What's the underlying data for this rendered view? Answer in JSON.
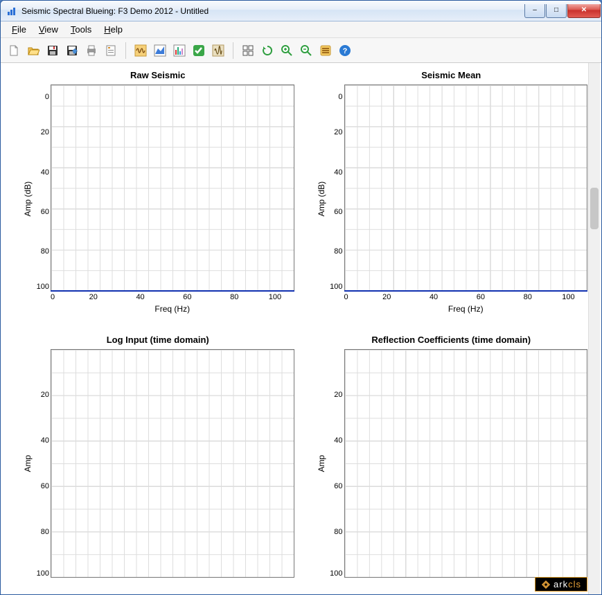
{
  "window": {
    "title": "Seismic Spectral Blueing: F3 Demo 2012 - Untitled"
  },
  "menubar": {
    "file": "File",
    "view": "View",
    "tools": "Tools",
    "help": "Help"
  },
  "toolbar": {
    "new": "new",
    "open": "open",
    "save": "save",
    "saveas": "save-as",
    "print": "print",
    "config": "config",
    "seismic": "seismic",
    "wave": "wave",
    "spectrum": "spectrum",
    "check": "check",
    "process": "process",
    "grid": "grid-view",
    "refresh": "refresh",
    "zoomin": "zoom-in",
    "zoomout": "zoom-out",
    "fit": "fit",
    "help": "help"
  },
  "chart_data": [
    {
      "id": "raw_seismic",
      "type": "line",
      "title": "Raw Seismic",
      "xlabel": "Freq (Hz)",
      "ylabel": "Amp (dB)",
      "xlim": [
        0,
        100
      ],
      "ylim": [
        0,
        100
      ],
      "xticks": [
        0,
        20,
        40,
        60,
        80,
        100
      ],
      "yticks": [
        0,
        20,
        40,
        60,
        80,
        100
      ],
      "series": [
        {
          "name": "raw",
          "x": [
            0,
            100
          ],
          "y": [
            0,
            0
          ]
        }
      ]
    },
    {
      "id": "seismic_mean",
      "type": "line",
      "title": "Seismic Mean",
      "xlabel": "Freq (Hz)",
      "ylabel": "Amp (dB)",
      "xlim": [
        0,
        100
      ],
      "ylim": [
        0,
        100
      ],
      "xticks": [
        0,
        20,
        40,
        60,
        80,
        100
      ],
      "yticks": [
        0,
        20,
        40,
        60,
        80,
        100
      ],
      "series": [
        {
          "name": "mean",
          "x": [
            0,
            100
          ],
          "y": [
            0,
            0
          ]
        }
      ]
    },
    {
      "id": "log_input",
      "type": "line",
      "title": "Log Input (time domain)",
      "xlabel": "",
      "ylabel": "Amp",
      "xlim": [
        0,
        100
      ],
      "ylim": [
        0,
        100
      ],
      "xticks": [],
      "yticks": [
        20,
        40,
        60,
        80,
        100
      ],
      "series": []
    },
    {
      "id": "refl_coef",
      "type": "line",
      "title": "Reflection Coefficients (time domain)",
      "xlabel": "",
      "ylabel": "Amp",
      "xlim": [
        0,
        100
      ],
      "ylim": [
        0,
        100
      ],
      "xticks": [],
      "yticks": [
        20,
        40,
        60,
        80,
        100
      ],
      "series": []
    }
  ],
  "brand": {
    "text1": "ark",
    "text2": "cls"
  }
}
